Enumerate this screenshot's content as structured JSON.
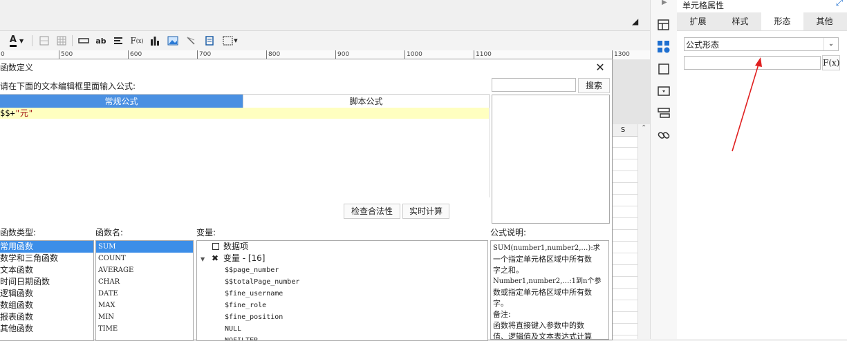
{
  "ruler": {
    "labels": [
      "500",
      "600",
      "700",
      "800",
      "900",
      "1000",
      "1100",
      "1300"
    ]
  },
  "sheet": {
    "column_label": "S"
  },
  "dialog": {
    "title": "函数定义",
    "prompt": "请在下面的文本编辑框里面输入公式:",
    "tabs": [
      "常规公式",
      "脚本公式"
    ],
    "formula_var": "$$+",
    "formula_str": "\"元\"",
    "search_label": "搜索",
    "check_label": "检查合法性",
    "calc_label": "实时计算",
    "func_type_label": "函数类型:",
    "func_name_label": "函数名:",
    "var_label": "变量:",
    "desc_label": "公式说明:",
    "func_types": [
      "常用函数",
      "数学和三角函数",
      "文本函数",
      "时间日期函数",
      "逻辑函数",
      "数组函数",
      "报表函数",
      "其他函数"
    ],
    "func_names": [
      "SUM",
      "COUNT",
      "AVERAGE",
      "CHAR",
      "DATE",
      "MAX",
      "MIN",
      "TIME"
    ],
    "var_root": "数据项",
    "var_group": "变量 - [16]",
    "variables": [
      "$$page_number",
      "$$totalPage_number",
      "$fine_username",
      "$fine_role",
      "$fine_position",
      "NULL",
      "NOFILTER"
    ],
    "desc_lines": [
      "SUM(number1,number2,…):求",
      "一个指定单元格区域中所有数",
      "字之和。",
      "Number1,number2,…:1到n个参",
      "数或指定单元格区域中所有数",
      "字。",
      "备注:",
      "函数将直接键入参数中的数",
      "值、逻辑值及文本表达式计算"
    ]
  },
  "panel": {
    "title": "单元格属性",
    "tabs": [
      "扩展",
      "样式",
      "形态",
      "其他"
    ],
    "active_tab": "形态",
    "select_value": "公式形态",
    "fx_label": "F(x)"
  },
  "colors": {
    "accent": "#4a90e2",
    "editor_highlight": "#ffffc0",
    "annotation_arrow": "#e02020"
  }
}
